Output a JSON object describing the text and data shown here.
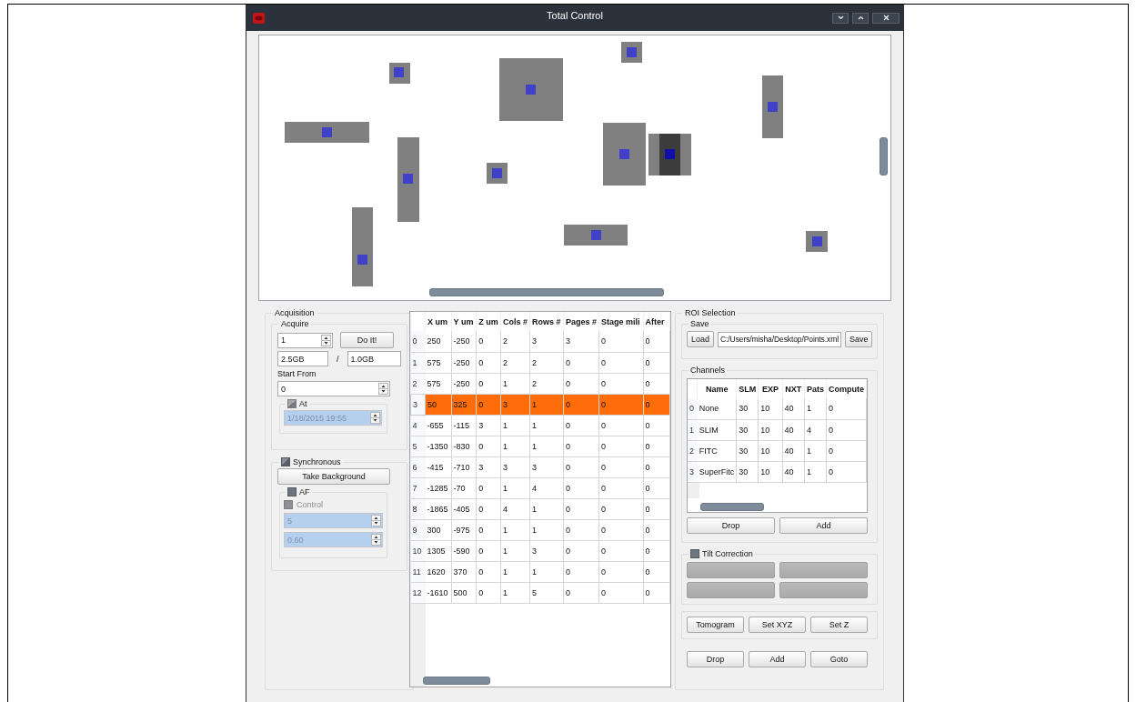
{
  "window": {
    "title": "Total Control"
  },
  "acquisition": {
    "title": "Acquisition",
    "acquire": {
      "title": "Acquire",
      "count": "1",
      "do_it": "Do It!",
      "size_used": "2.5GB",
      "separator": "/",
      "size_total": "1.0GB",
      "start_from_label": "Start From",
      "start_from": "0",
      "at": {
        "label": "At",
        "checked": true,
        "value": "1/18/2015 19:55",
        "disabled": true
      }
    },
    "synchronous": {
      "label": "Synchronous",
      "checked": true,
      "take_background": "Take Background",
      "af": {
        "label": "AF",
        "checked": false,
        "control": {
          "label": "Control",
          "checked": false,
          "disabled": true
        },
        "values": [
          {
            "value": "5",
            "disabled": true
          },
          {
            "value": "0.60",
            "disabled": true
          }
        ]
      }
    }
  },
  "points_table": {
    "columns": [
      "X um",
      "Y um",
      "Z um",
      "Cols #",
      "Rows #",
      "Pages #",
      "Stage mili",
      "After"
    ],
    "rows": [
      {
        "index": "0",
        "cells": [
          "250",
          "-250",
          "0",
          "2",
          "3",
          "3",
          "0",
          "0"
        ],
        "selected": false
      },
      {
        "index": "1",
        "cells": [
          "575",
          "-250",
          "0",
          "2",
          "2",
          "0",
          "0",
          "0"
        ],
        "selected": false
      },
      {
        "index": "2",
        "cells": [
          "575",
          "-250",
          "0",
          "1",
          "2",
          "0",
          "0",
          "0"
        ],
        "selected": false
      },
      {
        "index": "3",
        "cells": [
          "50",
          "325",
          "0",
          "3",
          "1",
          "0",
          "0",
          "0"
        ],
        "selected": true
      },
      {
        "index": "4",
        "cells": [
          "-655",
          "-115",
          "3",
          "1",
          "1",
          "0",
          "0",
          "0"
        ],
        "selected": false
      },
      {
        "index": "5",
        "cells": [
          "-1350",
          "-830",
          "0",
          "1",
          "1",
          "0",
          "0",
          "0"
        ],
        "selected": false
      },
      {
        "index": "6",
        "cells": [
          "-415",
          "-710",
          "3",
          "3",
          "3",
          "0",
          "0",
          "0"
        ],
        "selected": false
      },
      {
        "index": "7",
        "cells": [
          "-1285",
          "-70",
          "0",
          "1",
          "4",
          "0",
          "0",
          "0"
        ],
        "selected": false
      },
      {
        "index": "8",
        "cells": [
          "-1865",
          "-405",
          "0",
          "4",
          "1",
          "0",
          "0",
          "0"
        ],
        "selected": false
      },
      {
        "index": "9",
        "cells": [
          "300",
          "-975",
          "0",
          "1",
          "1",
          "0",
          "0",
          "0"
        ],
        "selected": false
      },
      {
        "index": "10",
        "cells": [
          "1305",
          "-590",
          "0",
          "1",
          "3",
          "0",
          "0",
          "0"
        ],
        "selected": false
      },
      {
        "index": "11",
        "cells": [
          "1620",
          "370",
          "0",
          "1",
          "1",
          "0",
          "0",
          "0"
        ],
        "selected": false
      },
      {
        "index": "12",
        "cells": [
          "-1610",
          "500",
          "0",
          "1",
          "5",
          "0",
          "0",
          "0"
        ],
        "selected": false
      }
    ]
  },
  "roi_selection": {
    "title": "ROI Selection",
    "save": {
      "title": "Save",
      "load": "Load",
      "path": "C:/Users/misha/Desktop/Points.xml",
      "save": "Save"
    },
    "channels": {
      "title": "Channels",
      "columns": [
        "Name",
        "SLM",
        "EXP",
        "NXT",
        "Pats",
        "Compute"
      ],
      "rows": [
        {
          "index": "0",
          "cells": [
            "None",
            "30",
            "10",
            "40",
            "1",
            "0"
          ]
        },
        {
          "index": "1",
          "cells": [
            "SLIM",
            "30",
            "10",
            "40",
            "4",
            "0"
          ]
        },
        {
          "index": "2",
          "cells": [
            "FITC",
            "30",
            "10",
            "40",
            "1",
            "0"
          ]
        },
        {
          "index": "3",
          "cells": [
            "SuperFitc",
            "30",
            "10",
            "40",
            "1",
            "0"
          ]
        }
      ],
      "buttons": [
        "Drop",
        "Add"
      ]
    },
    "tilt_correction": {
      "label": "Tilt Correction",
      "checked": false
    },
    "tools": [
      "Tomogram",
      "Set XYZ",
      "Set Z"
    ],
    "buttons": [
      "Drop",
      "Add",
      "Goto"
    ]
  }
}
